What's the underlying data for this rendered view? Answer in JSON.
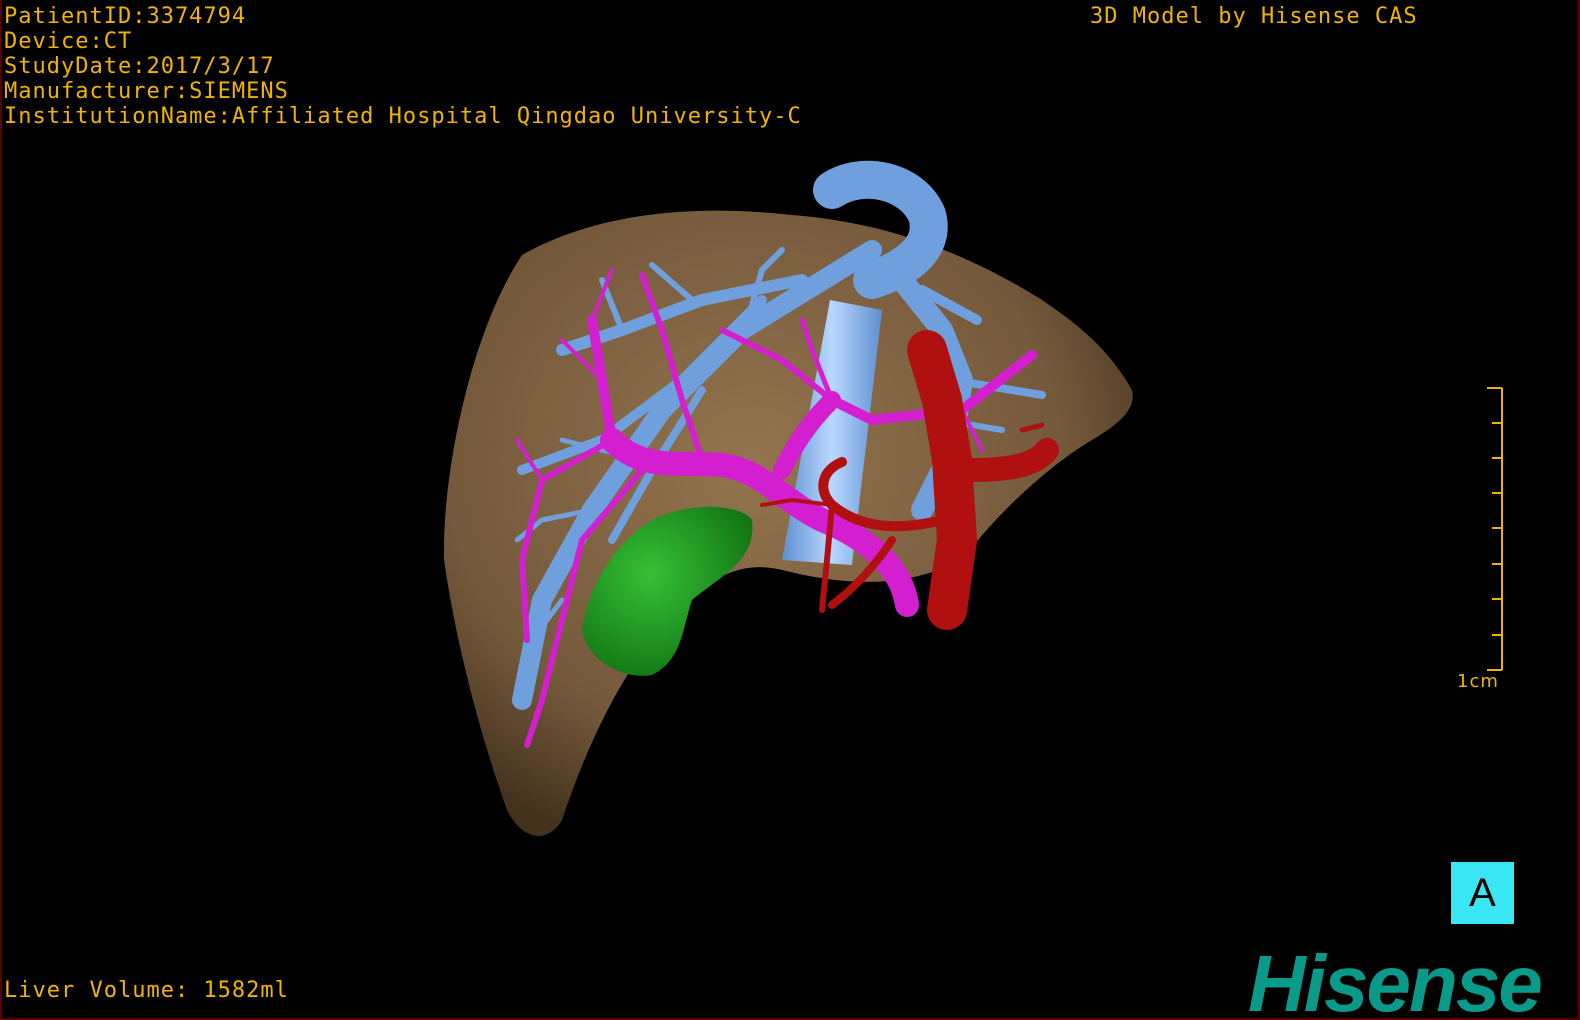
{
  "patient_info": {
    "patient_id": "PatientID:3374794",
    "device": "Device:CT",
    "study_date": "StudyDate:2017/3/17",
    "manufacturer": "Manufacturer:SIEMENS",
    "institution": "InstitutionName:Affiliated Hospital Qingdao University-C"
  },
  "header_right": "3D Model by Hisense CAS",
  "liver_volume": "Liver Volume: 1582ml",
  "scale_bar": {
    "label": "1cm"
  },
  "view_badge": "A",
  "brand": "Hisense",
  "colors": {
    "overlay_text": "#f0b400",
    "liver": "#8a6a46",
    "hepatic_vein": "#6f9fdc",
    "portal_vein": "#d41fd0",
    "artery": "#b01010",
    "gallbladder": "#1e9a1e",
    "view_badge": "#39e6f3",
    "brand": "#0a9a8a"
  }
}
